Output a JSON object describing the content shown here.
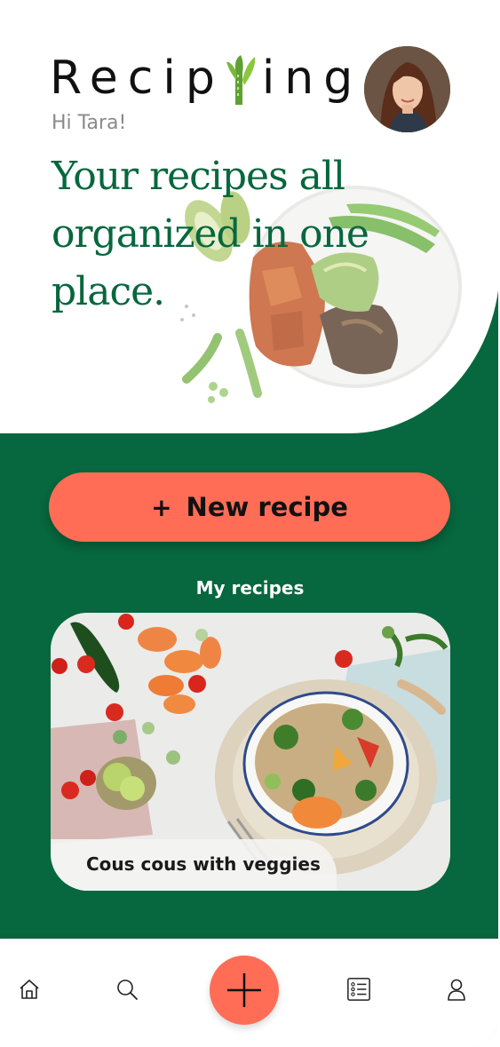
{
  "app": {
    "logo_text_left": "Recip",
    "logo_text_right": "ing",
    "greeting": "Hi Tara!",
    "headline": "Your recipes all organized in one place."
  },
  "actions": {
    "new_recipe_plus": "+",
    "new_recipe_label": "New recipe"
  },
  "recipes": {
    "section_title": "My recipes",
    "items": [
      {
        "title": "Cous cous with veggies"
      }
    ]
  },
  "nav": {
    "items": [
      {
        "icon": "home-icon"
      },
      {
        "icon": "search-icon"
      },
      {
        "icon": "add-icon"
      },
      {
        "icon": "list-icon"
      },
      {
        "icon": "profile-icon"
      }
    ]
  },
  "colors": {
    "brand_green": "#07673e",
    "accent_coral": "#ff6d56",
    "text_dark": "#111111"
  }
}
